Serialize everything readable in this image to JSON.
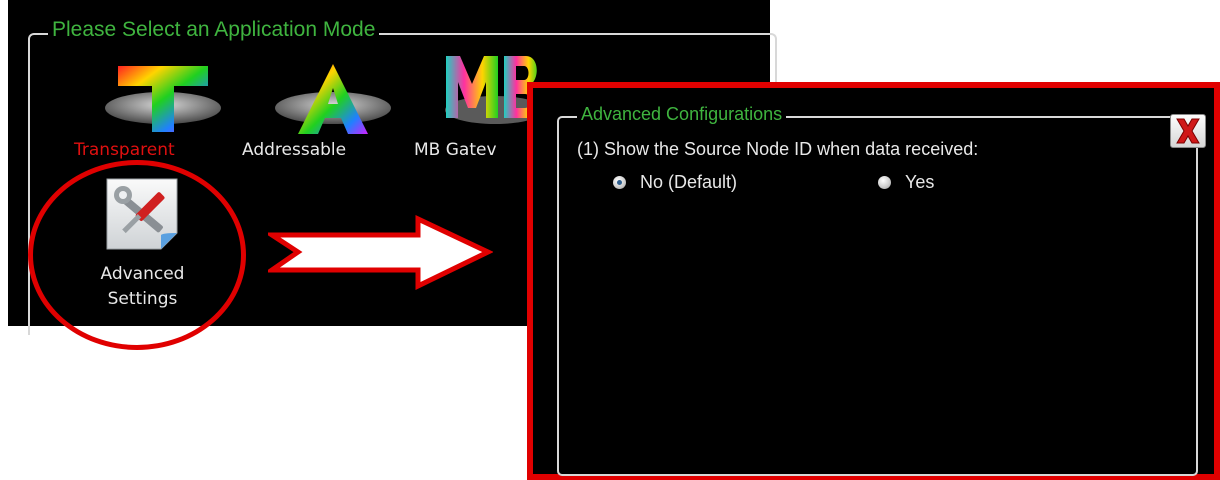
{
  "mode_panel": {
    "title": "Please Select an Application Mode",
    "modes": [
      {
        "label": "Transparent",
        "icon": "rainbow-T-icon",
        "selected": true
      },
      {
        "label": "Addressable",
        "icon": "rainbow-A-icon",
        "selected": false
      },
      {
        "label": "MB Gatev",
        "icon": "rainbow-MB-icon",
        "selected": false
      }
    ],
    "advanced": {
      "line1": "Advanced",
      "line2": "Settings",
      "icon": "wrench-screwdriver-icon"
    }
  },
  "dialog": {
    "title": "Advanced Configurations",
    "question": "(1) Show the Source Node ID when data received:",
    "options": [
      {
        "label": "No (Default)",
        "checked": true
      },
      {
        "label": "Yes",
        "checked": false
      }
    ],
    "close_icon": "close-x-icon"
  },
  "colors": {
    "accent_green": "#3fb43f",
    "highlight_red": "#e00000",
    "selected_label_red": "#e01010"
  }
}
